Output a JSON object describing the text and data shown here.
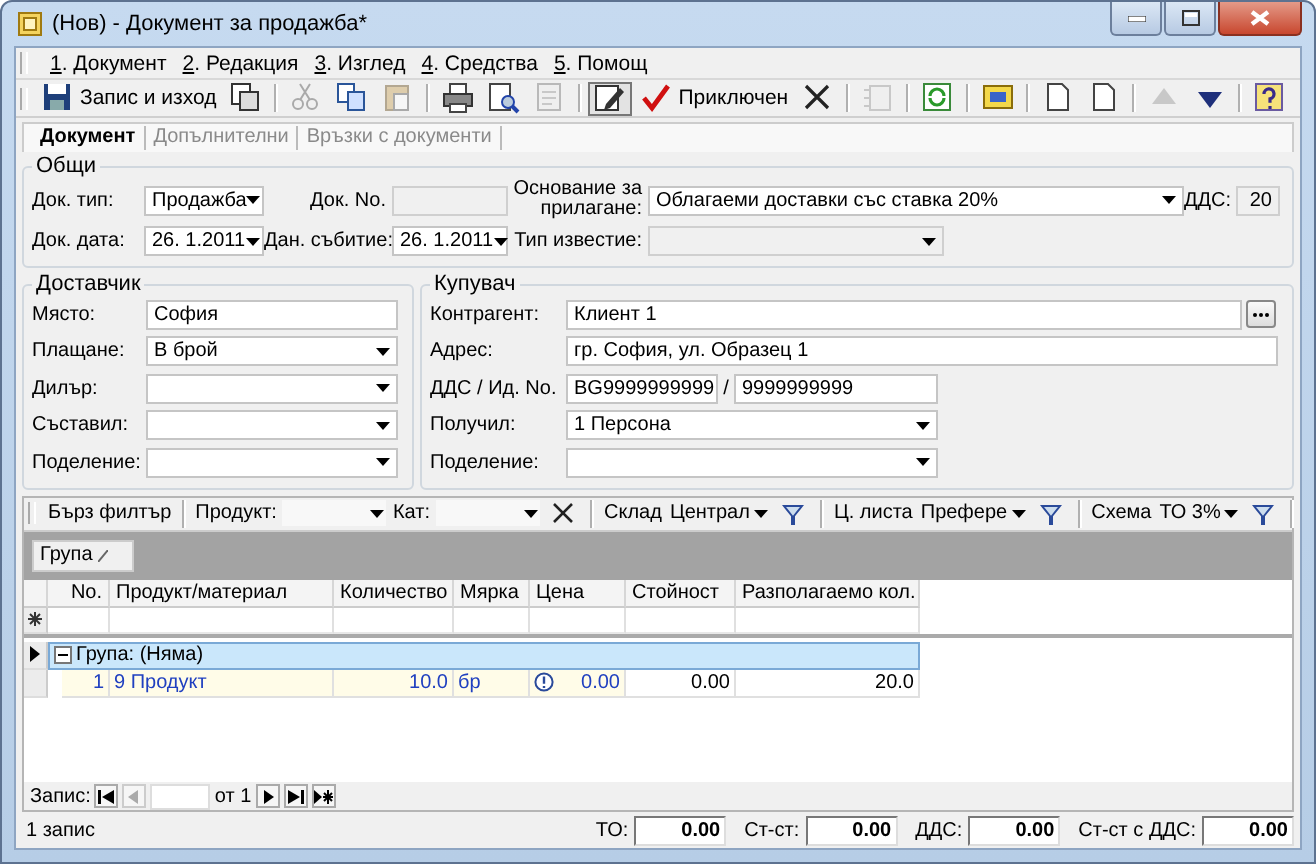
{
  "window": {
    "title": "(Нов) - Документ за продажба*"
  },
  "menu": [
    "1. Документ",
    "2. Редакция",
    "3. Изглед",
    "4. Средства",
    "5. Помощ"
  ],
  "toolbar": [
    {
      "kind": "button",
      "label": "Запис и изход",
      "disabled": false,
      "pressed": false
    },
    {
      "kind": "icon",
      "disabled": false,
      "pressed": false
    },
    {
      "kind": "separator"
    },
    {
      "kind": "icon",
      "disabled": true,
      "pressed": false
    },
    {
      "kind": "icon",
      "disabled": false,
      "pressed": false
    },
    {
      "kind": "icon",
      "disabled": true,
      "pressed": false
    },
    {
      "kind": "separator"
    },
    {
      "kind": "icon",
      "disabled": false,
      "pressed": false
    },
    {
      "kind": "icon",
      "disabled": false,
      "pressed": false
    },
    {
      "kind": "icon",
      "disabled": true,
      "pressed": false
    },
    {
      "kind": "separator"
    },
    {
      "kind": "icon",
      "disabled": false,
      "pressed": true
    },
    {
      "kind": "button",
      "label": "Приключен",
      "disabled": false,
      "pressed": false
    },
    {
      "kind": "icon",
      "disabled": false,
      "pressed": false
    },
    {
      "kind": "separator"
    },
    {
      "kind": "icon",
      "disabled": true,
      "pressed": false
    },
    {
      "kind": "separator"
    },
    {
      "kind": "icon",
      "disabled": false,
      "pressed": false
    },
    {
      "kind": "separator"
    },
    {
      "kind": "icon",
      "disabled": false,
      "pressed": false
    },
    {
      "kind": "separator"
    },
    {
      "kind": "icon",
      "disabled": false,
      "pressed": false
    },
    {
      "kind": "icon",
      "disabled": false,
      "pressed": false
    },
    {
      "kind": "separator"
    },
    {
      "kind": "icon",
      "disabled": true,
      "pressed": false
    },
    {
      "kind": "icon",
      "disabled": false,
      "pressed": false
    },
    {
      "kind": "separator"
    },
    {
      "kind": "icon",
      "disabled": false,
      "pressed": false
    }
  ],
  "tabs": [
    {
      "label": "Документ",
      "selected": true
    },
    {
      "label": "Допълнителни",
      "selected": false
    },
    {
      "label": "Връзки с документи",
      "selected": false
    }
  ],
  "general": {
    "title": "Общи",
    "doc_type": {
      "label": "Док. тип:",
      "value": "Продажба"
    },
    "doc_no": {
      "label": "Док. No.",
      "disabled": true
    },
    "basis": {
      "label": "Основание за прилагане:",
      "value": "Облагаеми доставки със ставка 20%"
    },
    "vat": {
      "label": "ДДС:",
      "value": "20",
      "disabled": true
    },
    "doc_date": {
      "label": "Док. дата:",
      "value": "26. 1.2011"
    },
    "event_date": {
      "label": "Дан. събитие:",
      "value": "26. 1.2011"
    },
    "notice_type": {
      "label": "Тип известие:",
      "disabled": true
    }
  },
  "supplier": {
    "title": "Доставчик",
    "fields": [
      {
        "kind": "text",
        "label": "Място:",
        "value": "София"
      },
      {
        "kind": "combo",
        "label": "Плащане:",
        "value": "В брой"
      },
      {
        "kind": "combo",
        "label": "Дилър:"
      },
      {
        "kind": "combo",
        "label": "Съставил:"
      },
      {
        "kind": "combo",
        "label": "Поделение:"
      }
    ]
  },
  "buyer": {
    "title": "Купувач",
    "fields": [
      {
        "kind": "lookup",
        "label": "Контрагент:",
        "value": "Клиент 1"
      },
      {
        "kind": "text",
        "label": "Адрес:",
        "value": "гр. София, ул. Образец 1"
      },
      {
        "kind": "pair",
        "label": "ДДС / Ид. No.",
        "value": "BG9999999999",
        "separator": "/",
        "value2": "9999999999"
      },
      {
        "kind": "combo",
        "label": "Получил:",
        "value": "1 Персона"
      },
      {
        "kind": "combo",
        "label": "Поделение:"
      }
    ]
  },
  "filter_bar": [
    {
      "kind": "label",
      "text": "Бърз филтър"
    },
    {
      "kind": "combo",
      "label": "Продукт:"
    },
    {
      "kind": "combo",
      "label": "Кат:"
    },
    {
      "kind": "clear"
    },
    {
      "kind": "combo",
      "label": "Склад",
      "value": "Централ"
    },
    {
      "kind": "icon"
    },
    {
      "kind": "combo",
      "label": "Ц. листа",
      "value": "Префере"
    },
    {
      "kind": "icon"
    },
    {
      "kind": "combo",
      "label": "Схема",
      "value": "ТО 3%"
    },
    {
      "kind": "icon"
    }
  ],
  "group_panel": {
    "chip": "Група"
  },
  "grid": {
    "columns": [
      {
        "label": "No.",
        "editable": true
      },
      {
        "label": "Продукт/материал",
        "editable": true
      },
      {
        "label": "Количество",
        "editable": true
      },
      {
        "label": "Мярка",
        "editable": true
      },
      {
        "label": "Цена",
        "editable": true
      },
      {
        "label": "Стойност",
        "editable": false
      },
      {
        "label": "Разполагаемо кол.",
        "editable": false
      }
    ],
    "groups": [
      {
        "label": "Група: (Няма)",
        "expanded": true,
        "current": true,
        "rows": [
          {
            "cells": [
              "1",
              "9 Продукт",
              "10.0",
              "бр",
              "0.00",
              "0.00",
              "20.0"
            ]
          }
        ]
      }
    ]
  },
  "navigator": {
    "label": "Запис:",
    "of": "от 1"
  },
  "status_bar": {
    "records": "1 запис",
    "totals": [
      {
        "label": "ТО:",
        "value": "0.00"
      },
      {
        "label": "Ст-ст:",
        "value": "0.00"
      },
      {
        "label": "ДДС:",
        "value": "0.00"
      },
      {
        "label": "Ст-ст с ДДС:",
        "value": "0.00"
      }
    ]
  }
}
